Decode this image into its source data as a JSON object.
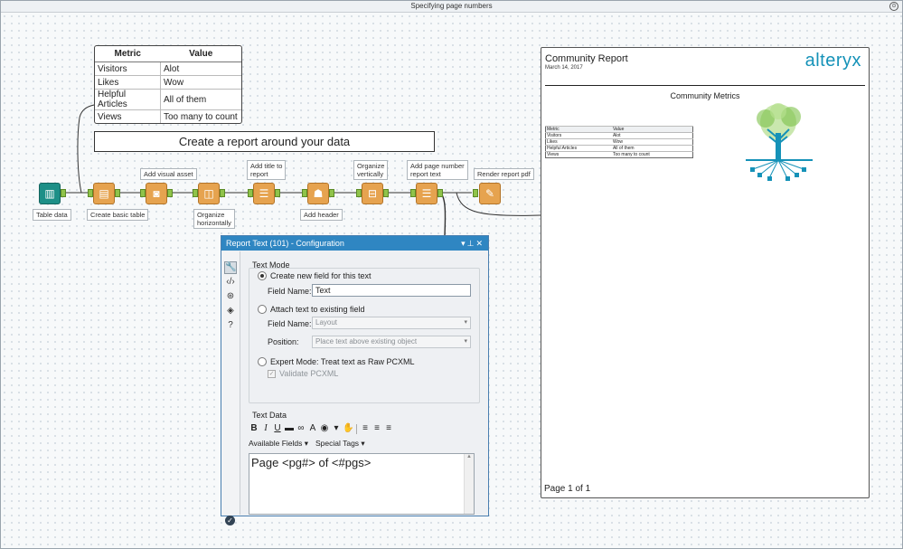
{
  "window": {
    "title": "Specifying page numbers"
  },
  "metric_table": {
    "headers": [
      "Metric",
      "Value"
    ],
    "rows": [
      [
        "Visitors",
        "Alot"
      ],
      [
        "Likes",
        "Wow"
      ],
      [
        "Helpful Articles",
        "All of them"
      ],
      [
        "Views",
        "Too many to count"
      ]
    ]
  },
  "banner": {
    "text": "Create a report around your data"
  },
  "tools": [
    {
      "label": "Table data",
      "icon": "book-icon"
    },
    {
      "label": "Create basic table",
      "icon": "table-icon"
    },
    {
      "label": "Add visual asset",
      "icon": "camera-icon"
    },
    {
      "label": "Organize horizontally",
      "icon": "layout-horizontal-icon"
    },
    {
      "label": "Add title to report",
      "icon": "report-text-icon"
    },
    {
      "label": "Add header",
      "icon": "header-icon"
    },
    {
      "label": "Organize vertically",
      "icon": "layout-vertical-icon"
    },
    {
      "label": "Add page number report text",
      "icon": "report-text-icon"
    },
    {
      "label": "Render report pdf",
      "icon": "render-icon"
    }
  ],
  "tool_labels": {
    "t1": "Table data",
    "t2": "Create basic table",
    "t3": "Add visual asset",
    "t4a": "Organize",
    "t4b": "horizontally",
    "t5a": "Add title to",
    "t5b": "report",
    "t6": "Add header",
    "t7a": "Organize",
    "t7b": "vertically",
    "t8a": "Add page number",
    "t8b": "report text",
    "t9": "Render report pdf"
  },
  "report": {
    "title": "Community Report",
    "date": "March 14, 2017",
    "logo": "alteryx",
    "heading": "Community Metrics",
    "table_headers": [
      "Metric",
      "Value"
    ],
    "table_rows": [
      [
        "Visitors",
        "Alot"
      ],
      [
        "Likes",
        "Wow"
      ],
      [
        "Helpful Articles",
        "All of them"
      ],
      [
        "Views",
        "Too many to count"
      ]
    ],
    "page": "Page 1 of 1"
  },
  "panel": {
    "title": "Report Text (101) - Configuration",
    "text_mode_label": "Text Mode",
    "opt_create": "Create new field for this text",
    "field_name_label": "Field Name:",
    "field_name_value": "Text",
    "opt_attach": "Attach text to existing field",
    "field_name_label2": "Field Name:",
    "attach_field_value": "Layout",
    "position_label": "Position:",
    "position_value": "Place text above existing object",
    "opt_expert": "Expert Mode: Treat text as Raw PCXML",
    "validate_label": "Validate PCXML",
    "text_data_label": "Text Data",
    "available_fields": "Available Fields ▾",
    "special_tags": "Special Tags ▾",
    "editor_text": "Page <pg#> of <#pgs>"
  },
  "colors": {
    "tool_orange": "#e6a34f",
    "tool_teal": "#1d8f87",
    "panel_header": "#2f86c2",
    "logo_blue": "#1592b8"
  }
}
